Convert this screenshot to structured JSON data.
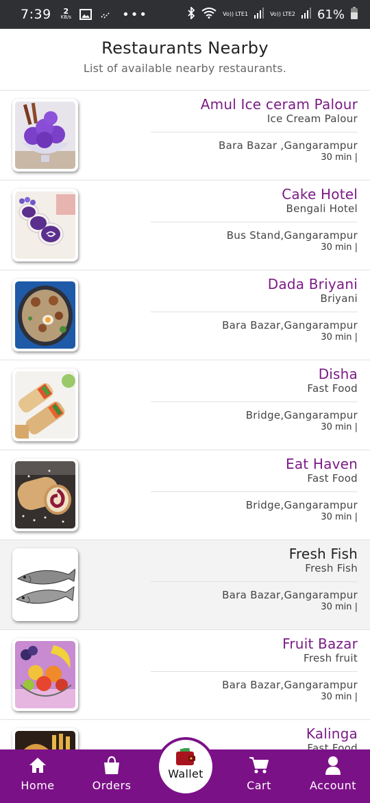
{
  "status_bar": {
    "time": "7:39",
    "speed_value": "2",
    "speed_unit": "KB/s",
    "dots": "•••",
    "sim1": "Vo)) LTE1",
    "sim2": "Vo)) LTE2",
    "battery": "61%"
  },
  "header": {
    "title": "Restaurants Nearby",
    "subtitle": "List of available nearby restaurants."
  },
  "restaurants": [
    {
      "name": "Amul Ice ceram Palour",
      "category": "Ice Cream Palour",
      "address": "Bara Bazar ,Gangarampur",
      "time": "30 min |",
      "image": "ice-cream"
    },
    {
      "name": "Cake Hotel",
      "category": "Bengali Hotel",
      "address": "Bus Stand,Gangarampur",
      "time": "30 min |",
      "image": "cake-roll"
    },
    {
      "name": "Dada Briyani",
      "category": "Briyani",
      "address": "Bara Bazar,Gangarampur",
      "time": "30 min |",
      "image": "biryani"
    },
    {
      "name": "Disha",
      "category": "Fast Food",
      "address": "Bridge,Gangarampur",
      "time": "30 min |",
      "image": "wraps"
    },
    {
      "name": "Eat Haven",
      "category": "Fast Food",
      "address": "Bridge,Gangarampur",
      "time": "30 min |",
      "image": "swiss-roll"
    },
    {
      "name": "Fresh Fish",
      "category": "Fresh Fish",
      "address": "Bara Bazar,Gangarampur",
      "time": "30 min |",
      "image": "fish"
    },
    {
      "name": "Fruit Bazar",
      "category": "Fresh fruit",
      "address": "Bara Bazar,Gangarampur",
      "time": "30 min |",
      "image": "fruits"
    },
    {
      "name": "Kalinga",
      "category": "Fast Food",
      "address": "",
      "time": "",
      "image": "burger"
    }
  ],
  "bottom_nav": {
    "home": "Home",
    "orders": "Orders",
    "wallet": "Wallet",
    "cart": "Cart",
    "account": "Account"
  },
  "colors": {
    "accent": "#7b1187",
    "name_text": "#7b1b86",
    "status_bar": "#2f3033"
  }
}
